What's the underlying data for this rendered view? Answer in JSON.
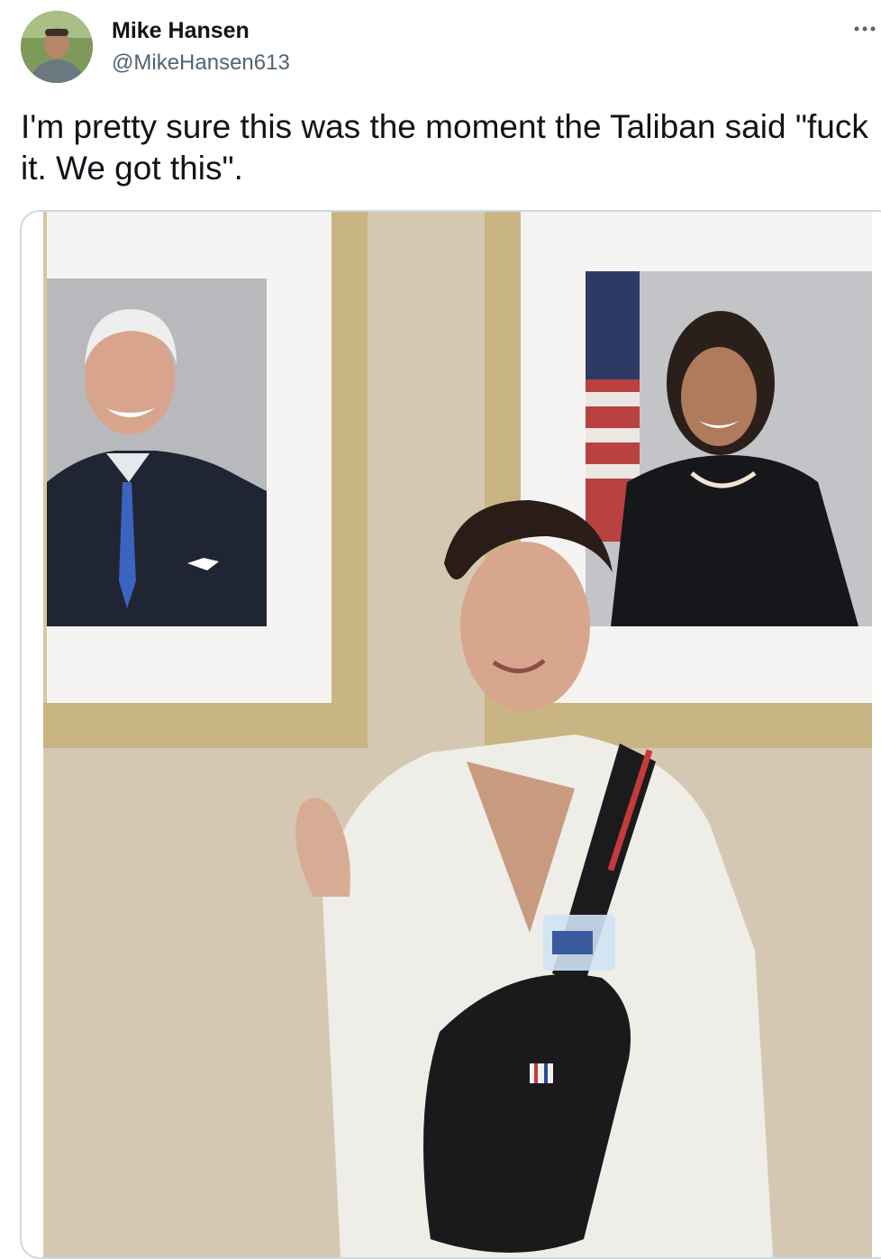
{
  "author": {
    "name": "Mike Hansen",
    "handle": "@MikeHansen613",
    "avatar_icon": "profile-photo"
  },
  "more_icon": "more-horizontal-icon",
  "tweet": {
    "text": "I'm pretty sure this was the moment the Taliban said \"fuck it. We got this\"."
  },
  "media": {
    "type": "photo"
  },
  "colors": {
    "text": "#0f1419",
    "secondary": "#536471",
    "border": "#cfd9de"
  }
}
